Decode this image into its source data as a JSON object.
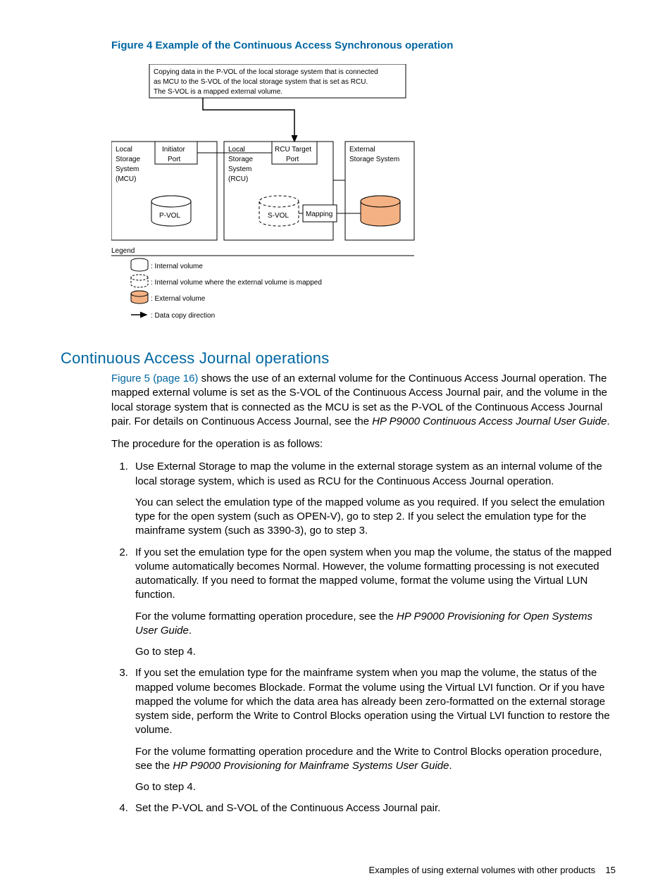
{
  "figure": {
    "label": "Figure 4  Example of the Continuous Access Synchronous operation",
    "caption_line1": "Copying data in the P-VOL of the local storage system that is connected",
    "caption_line2": "as MCU to the S-VOL of the local storage system that is set as RCU.",
    "caption_line3": "The S-VOL is a mapped external volume.",
    "local_mcu_l1": "Local",
    "local_mcu_l2": "Storage",
    "local_mcu_l3": "System",
    "local_mcu_l4": "(MCU)",
    "initiator_l1": "Initiator",
    "initiator_l2": "Port",
    "local_rcu_l1": "Local",
    "local_rcu_l2": "Storage",
    "local_rcu_l3": "System",
    "local_rcu_l4": "(RCU)",
    "rcu_target_l1": "RCU Target",
    "rcu_target_l2": "Port",
    "external_l1": "External",
    "external_l2": "Storage System",
    "pvol": "P-VOL",
    "svol": "S-VOL",
    "mapping": "Mapping",
    "legend_title": "Legend",
    "legend_internal": ": Internal volume",
    "legend_mapped": ": Internal volume where the external volume is mapped",
    "legend_external": ": External volume",
    "legend_arrow": ": Data copy direction"
  },
  "section": {
    "heading": "Continuous Access Journal operations",
    "link_text": "Figure 5 (page 16)",
    "para1_rest": " shows the use of an external volume for the Continuous Access Journal operation. The mapped external volume is set as the S-VOL of the Continuous Access Journal pair, and the volume in the local storage system that is connected as the MCU is set as the P-VOL of the Continuous Access Journal pair. For details on Continuous Access Journal, see the ",
    "para1_em": "HP P9000 Continuous Access Journal User Guide",
    "para1_end": ".",
    "para2": "The procedure for the operation is as follows:",
    "step1a": "Use External Storage to map the volume in the external storage system as an internal volume of the local storage system, which is used as RCU for the Continuous Access Journal operation.",
    "step1b": "You can select the emulation type of the mapped volume as you required. If you select the emulation type for the open system (such as OPEN-V), go to step 2. If you select the emulation type for the mainframe system (such as 3390-3), go to step 3.",
    "step2a": "If you set the emulation type for the open system when you map the volume, the status of the mapped volume automatically becomes Normal. However, the volume formatting processing is not executed automatically. If you need to format the mapped volume, format the volume using the Virtual LUN function.",
    "step2b_pre": "For the volume formatting operation procedure, see the ",
    "step2b_em": "HP P9000 Provisioning for Open Systems User Guide",
    "step2b_post": ".",
    "step2c": "Go to step 4.",
    "step3a": "If you set the emulation type for the mainframe system when you map the volume, the status of the mapped volume becomes Blockade. Format the volume using the Virtual LVI function. Or if you have mapped the volume for which the data area has already been zero-formatted on the external storage system side, perform the Write to Control Blocks operation using the Virtual LVI function to restore the volume.",
    "step3b_pre": "For the volume formatting operation procedure and the Write to Control Blocks operation procedure, see the ",
    "step3b_em": "HP P9000 Provisioning for Mainframe Systems User Guide",
    "step3b_post": ".",
    "step3c": "Go to step 4.",
    "step4": "Set the P-VOL and S-VOL of the Continuous Access Journal pair."
  },
  "footer": {
    "text": "Examples of using external volumes with other products",
    "page": "15"
  }
}
